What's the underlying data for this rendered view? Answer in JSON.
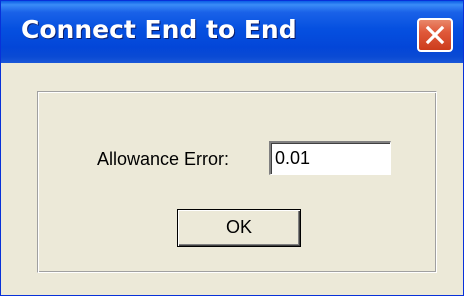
{
  "window": {
    "title": "Connect End to End",
    "close_icon": "close-icon",
    "colors": {
      "titlebar": "#0550e0",
      "close_button": "#e0593a",
      "face": "#ece9d8"
    }
  },
  "form": {
    "allowance_label": "Allowance Error:",
    "allowance_value": "0.01",
    "ok_label": "OK"
  }
}
